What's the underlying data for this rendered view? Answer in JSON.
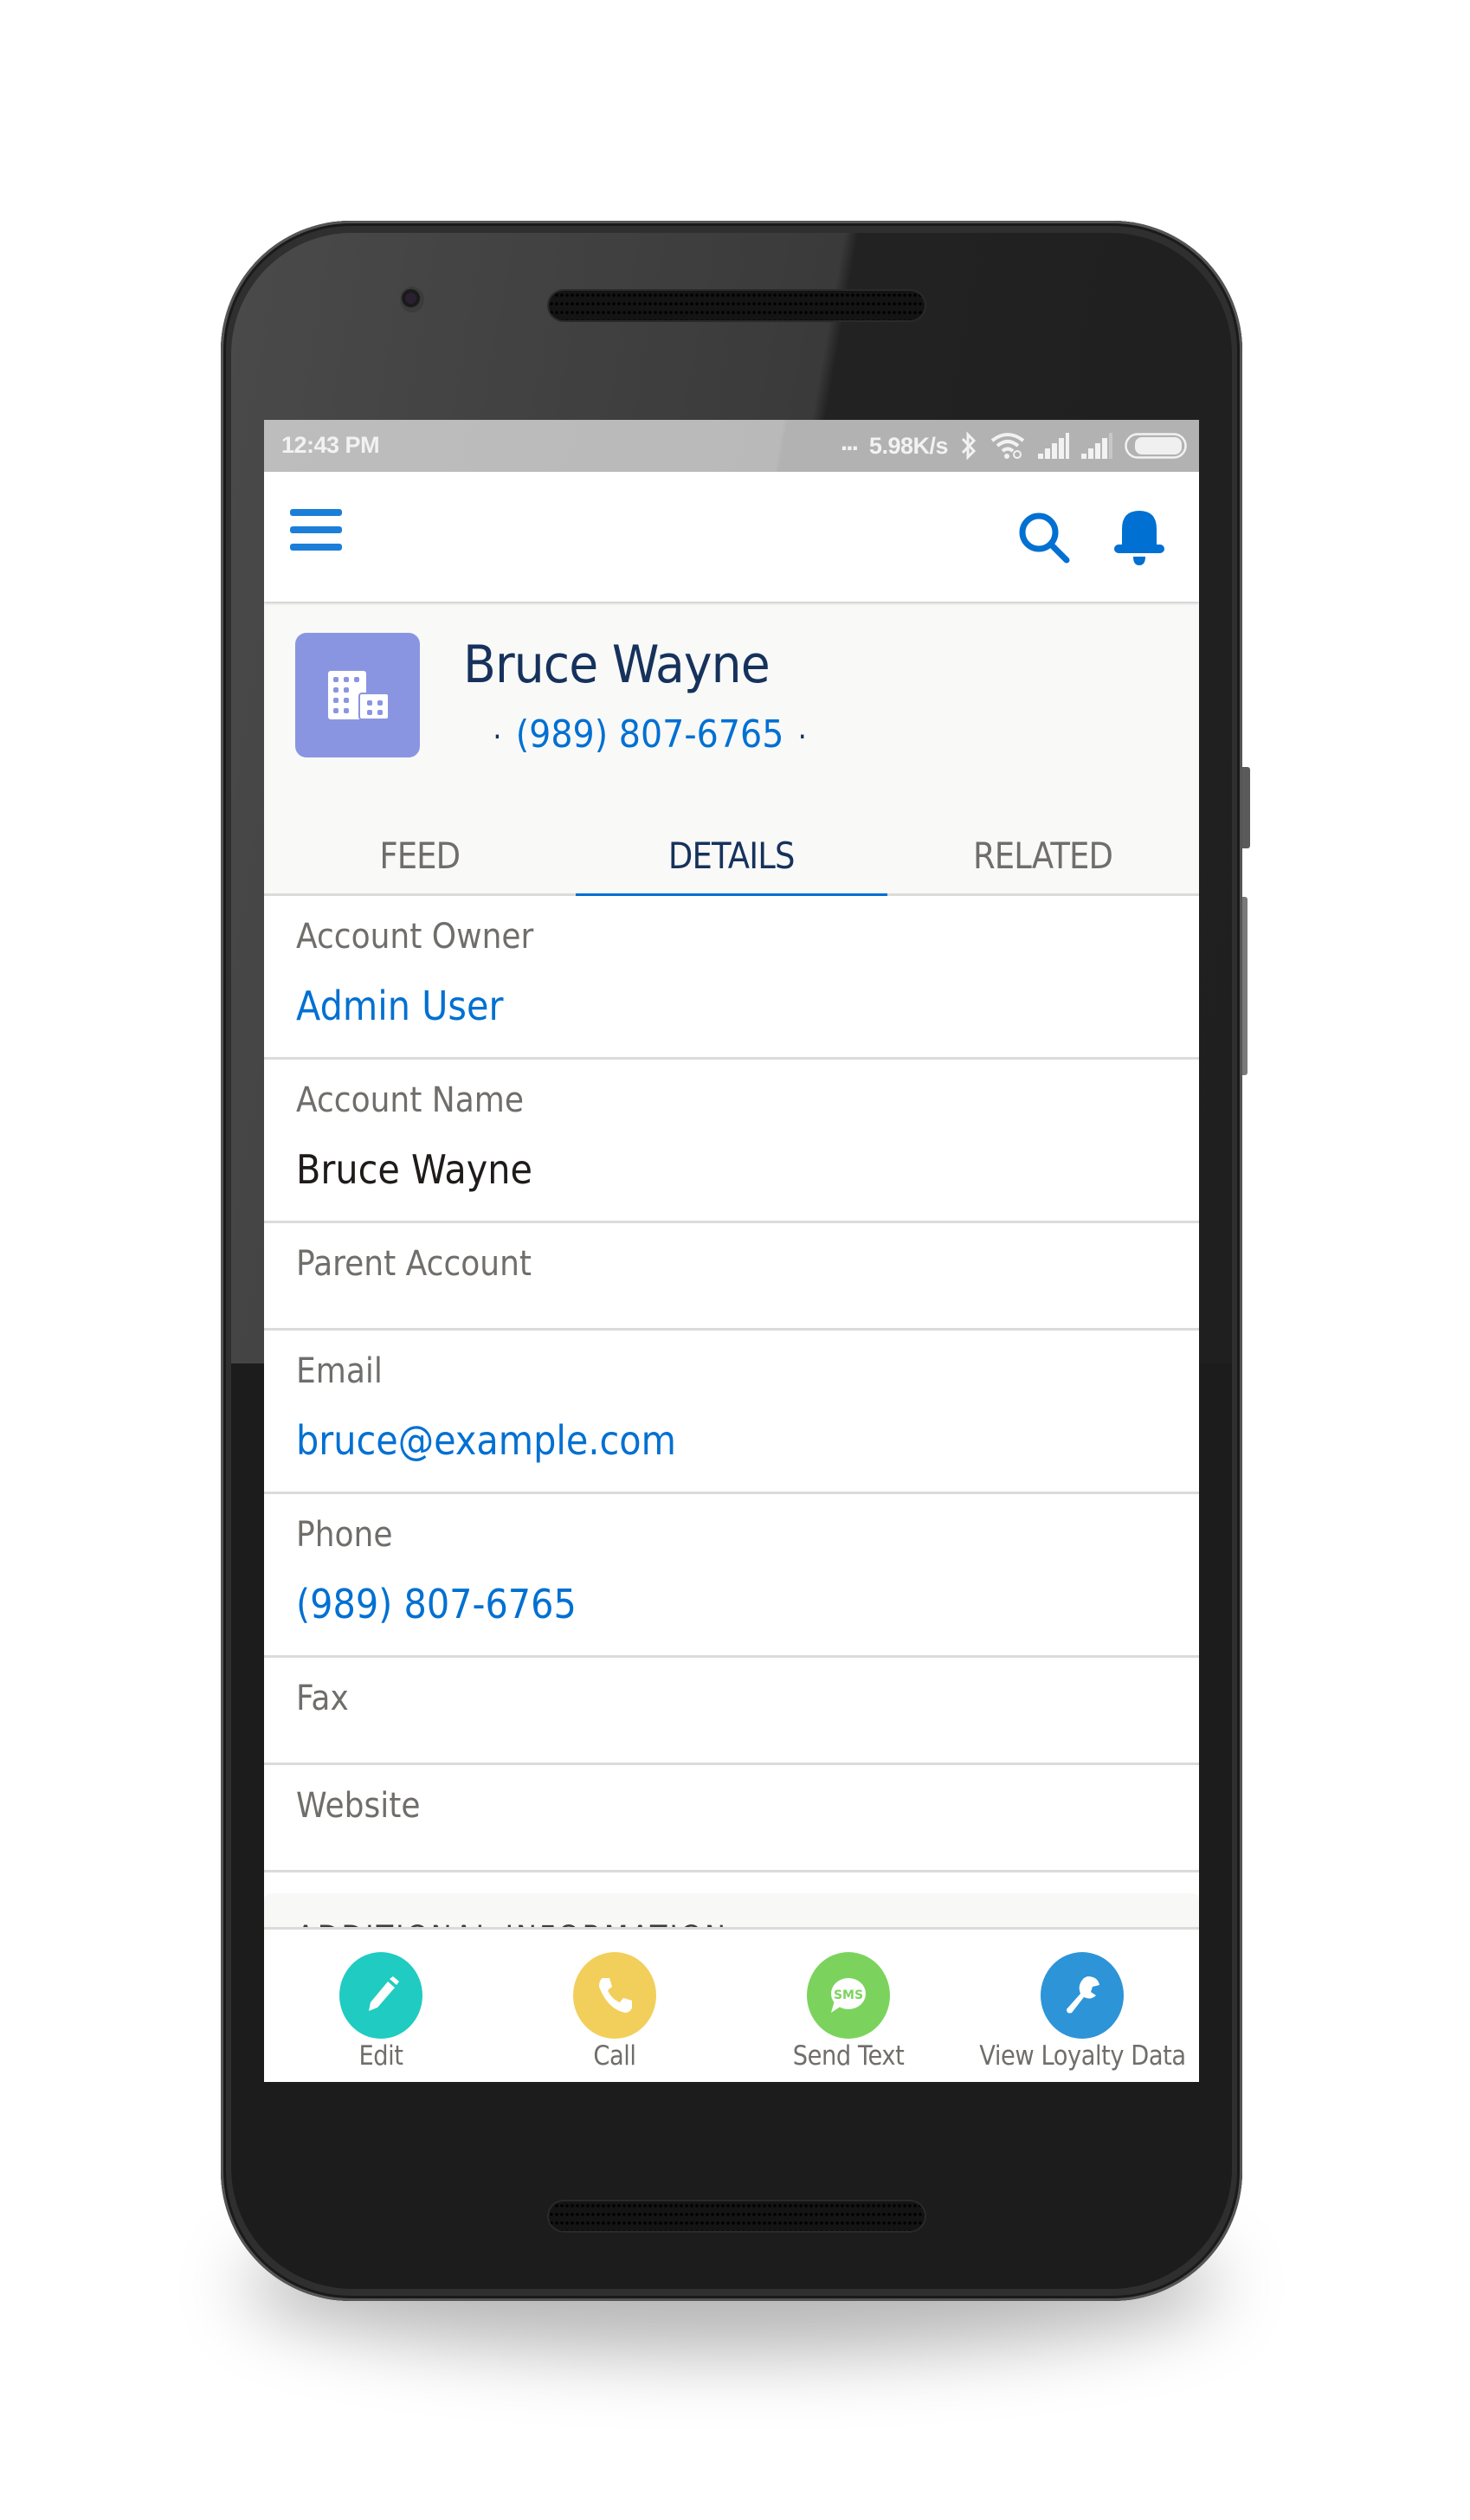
{
  "status_bar": {
    "time": "12:43 PM",
    "dots": "...",
    "network_speed": "5.98K/s",
    "icons": [
      "bluetooth-icon",
      "wifi-icon",
      "signal-icon",
      "signal-icon",
      "battery-icon"
    ]
  },
  "nav": {
    "menu_icon": "hamburger-menu-icon",
    "search_icon": "search-icon",
    "notifications_icon": "bell-icon",
    "accent_color": "#1b7fd9"
  },
  "record": {
    "icon": "account-building-icon",
    "icon_color": "#8a95e2",
    "name": "Bruce Wayne",
    "phone": "(989) 807-6765",
    "separator": "·"
  },
  "tabs": [
    {
      "label": "FEED",
      "active": false
    },
    {
      "label": "DETAILS",
      "active": true
    },
    {
      "label": "RELATED",
      "active": false
    }
  ],
  "fields": [
    {
      "label": "Account Owner",
      "value": "Admin User",
      "link": true
    },
    {
      "label": "Account Name",
      "value": "Bruce Wayne",
      "link": false
    },
    {
      "label": "Parent Account",
      "value": "",
      "link": false
    },
    {
      "label": "Email",
      "value": "bruce@example.com",
      "link": true
    },
    {
      "label": "Phone",
      "value": "(989) 807-6765",
      "link": true
    },
    {
      "label": "Fax",
      "value": "",
      "link": false
    },
    {
      "label": "Website",
      "value": "",
      "link": false
    }
  ],
  "section_header": "ADDITIONAL INFORMATION",
  "actions": [
    {
      "label": "Edit",
      "icon": "pencil-icon",
      "color": "#20cbc1"
    },
    {
      "label": "Call",
      "icon": "phone-icon",
      "color": "#f2cf5b"
    },
    {
      "label": "Send Text",
      "icon": "sms-icon",
      "color": "#7bd35d"
    },
    {
      "label": "View Loyalty Data",
      "icon": "wrench-icon",
      "color": "#2d94d8"
    }
  ],
  "colors": {
    "link": "#0070d2",
    "title": "#16325c",
    "label": "#706e6b",
    "active_tab_indicator": "#0070d2"
  }
}
